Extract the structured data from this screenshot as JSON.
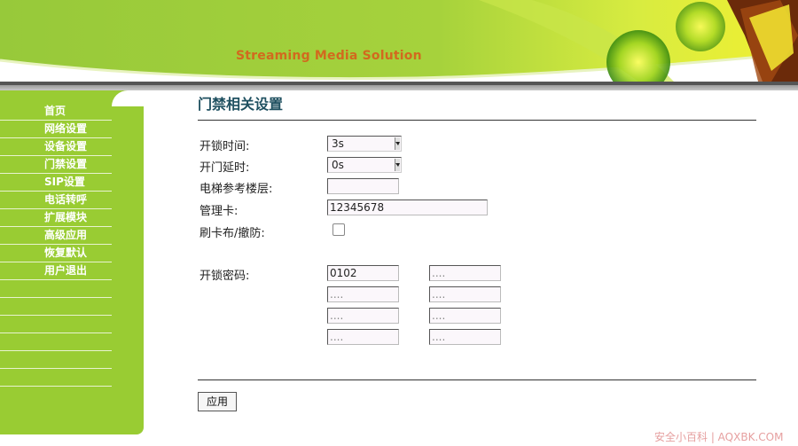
{
  "header": {
    "title": "Streaming Media Solution"
  },
  "sidebar": {
    "items": [
      {
        "label": "首页"
      },
      {
        "label": "网络设置"
      },
      {
        "label": "设备设置"
      },
      {
        "label": "门禁设置"
      },
      {
        "label": "SIP设置"
      },
      {
        "label": "电话转呼"
      },
      {
        "label": "扩展模块"
      },
      {
        "label": "高级应用"
      },
      {
        "label": "恢复默认"
      },
      {
        "label": "用户退出"
      }
    ]
  },
  "main": {
    "title": "门禁相关设置",
    "fields": {
      "unlock_time": {
        "label": "开锁时间:",
        "value": "3s"
      },
      "door_delay": {
        "label": "开门延时:",
        "value": "0s"
      },
      "elevator_floor": {
        "label": "电梯参考楼层:",
        "value": ""
      },
      "admin_card": {
        "label": "管理卡:",
        "value": "12345678"
      },
      "card_arm": {
        "label": "刷卡布/撤防:"
      },
      "unlock_password": {
        "label": "开锁密码:",
        "values": [
          "0102",
          "....",
          "....",
          "....",
          "....",
          "....",
          "....",
          "...."
        ]
      }
    },
    "apply_label": "应用"
  },
  "watermark": "安全小百科 | AQXBK.COM",
  "colors": {
    "sidebar": "#99cc33",
    "title": "#1f5060",
    "header_text": "#d2691e"
  }
}
